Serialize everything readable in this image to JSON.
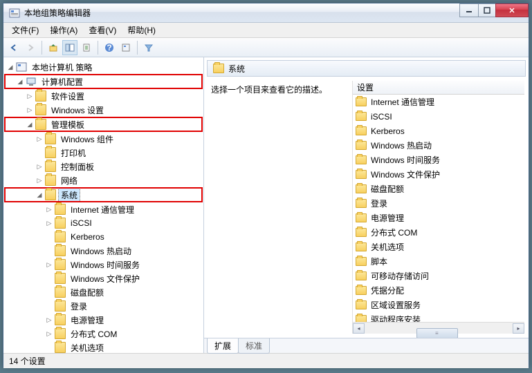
{
  "window": {
    "title": "本地组策略编辑器"
  },
  "menu": {
    "file": "文件(F)",
    "action": "操作(A)",
    "view": "查看(V)",
    "help": "帮助(H)"
  },
  "tree": {
    "root": "本地计算机 策略",
    "computer_config": "计算机配置",
    "software_settings": "软件设置",
    "windows_settings": "Windows 设置",
    "admin_templates": "管理模板",
    "windows_components": "Windows 组件",
    "printers": "打印机",
    "control_panel": "控制面板",
    "network": "网络",
    "system": "系统",
    "internet_comm": "Internet 通信管理",
    "iscsi": "iSCSI",
    "kerberos": "Kerberos",
    "windows_hotstart": "Windows 热启动",
    "windows_time": "Windows 时间服务",
    "windows_fileprotect": "Windows 文件保护",
    "disk_quota": "磁盘配额",
    "logon": "登录",
    "power_mgmt": "电源管理",
    "dcom": "分布式 COM",
    "shutdown_opts": "关机选项"
  },
  "right": {
    "header": "系统",
    "desc": "选择一个项目来查看它的描述。",
    "col_settings": "设置",
    "items": {
      "0": "Internet 通信管理",
      "1": "iSCSI",
      "2": "Kerberos",
      "3": "Windows 热启动",
      "4": "Windows 时间服务",
      "5": "Windows 文件保护",
      "6": "磁盘配额",
      "7": "登录",
      "8": "电源管理",
      "9": "分布式 COM",
      "10": "关机选项",
      "11": "脚本",
      "12": "可移动存储访问",
      "13": "凭据分配",
      "14": "区域设置服务",
      "15": "驱动程序安装"
    }
  },
  "tabs": {
    "extended": "扩展",
    "standard": "标准"
  },
  "status": {
    "text": "14 个设置"
  }
}
